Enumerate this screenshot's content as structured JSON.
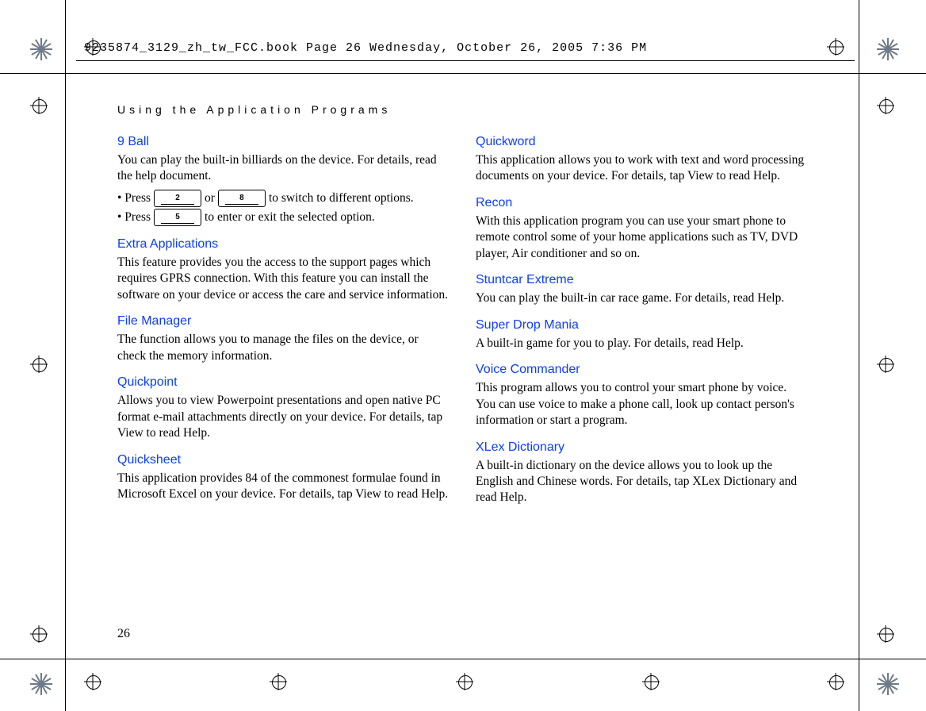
{
  "header_text": "9235874_3129_zh_tw_FCC.book  Page 26  Wednesday, October 26, 2005  7:36 PM",
  "running_head": "Using the Application Programs",
  "page_number": "26",
  "keys": {
    "k2": "2",
    "k8": "8",
    "k5": "5"
  },
  "left": {
    "nine_ball": {
      "title": "9 Ball",
      "body": "You can play the built-in billiards on the device. For details, read the help document.",
      "line1_a": "• Press ",
      "line1_b": " or ",
      "line1_c": " to switch to different options.",
      "line2_a": "• Press ",
      "line2_b": " to enter or exit the selected option."
    },
    "extra_apps": {
      "title": "Extra Applications",
      "body": "This feature provides you the access to the support pages which requires GPRS connection. With this feature you can install the software on your device or access the care and service information."
    },
    "file_manager": {
      "title": "File Manager",
      "body": "The function allows you to manage the files on the device, or check the memory information."
    },
    "quickpoint": {
      "title": "Quickpoint",
      "body": "Allows you to view Powerpoint presentations and open native PC format e-mail attachments directly on your device. For details, tap View to read Help."
    },
    "quicksheet": {
      "title": "Quicksheet",
      "body": "This application provides 84 of the commonest formulae found in Microsoft Excel on your device. For details, tap View to read Help."
    }
  },
  "right": {
    "quickword": {
      "title": "Quickword",
      "body": "This application allows you to work with text and word processing documents on your device. For details, tap View to read Help."
    },
    "recon": {
      "title": "Recon",
      "body": "With this application program you can use your smart phone to remote control some of your home applications such as TV, DVD player, Air conditioner and so on."
    },
    "stuntcar": {
      "title": "Stuntcar Extreme",
      "body": "You can play the built-in car race game. For details, read Help."
    },
    "superdrop": {
      "title": "Super Drop Mania",
      "body": "A built-in game for you to play. For details, read Help."
    },
    "voicecmd": {
      "title": "Voice Commander",
      "body": "This program allows you to control your smart phone by voice. You can use voice to make a phone call, look up contact person's information or start a program."
    },
    "xlex": {
      "title": "XLex Dictionary",
      "body": "A built-in dictionary on the device allows you to look up the English and Chinese words. For details, tap XLex Dictionary and read Help."
    }
  }
}
